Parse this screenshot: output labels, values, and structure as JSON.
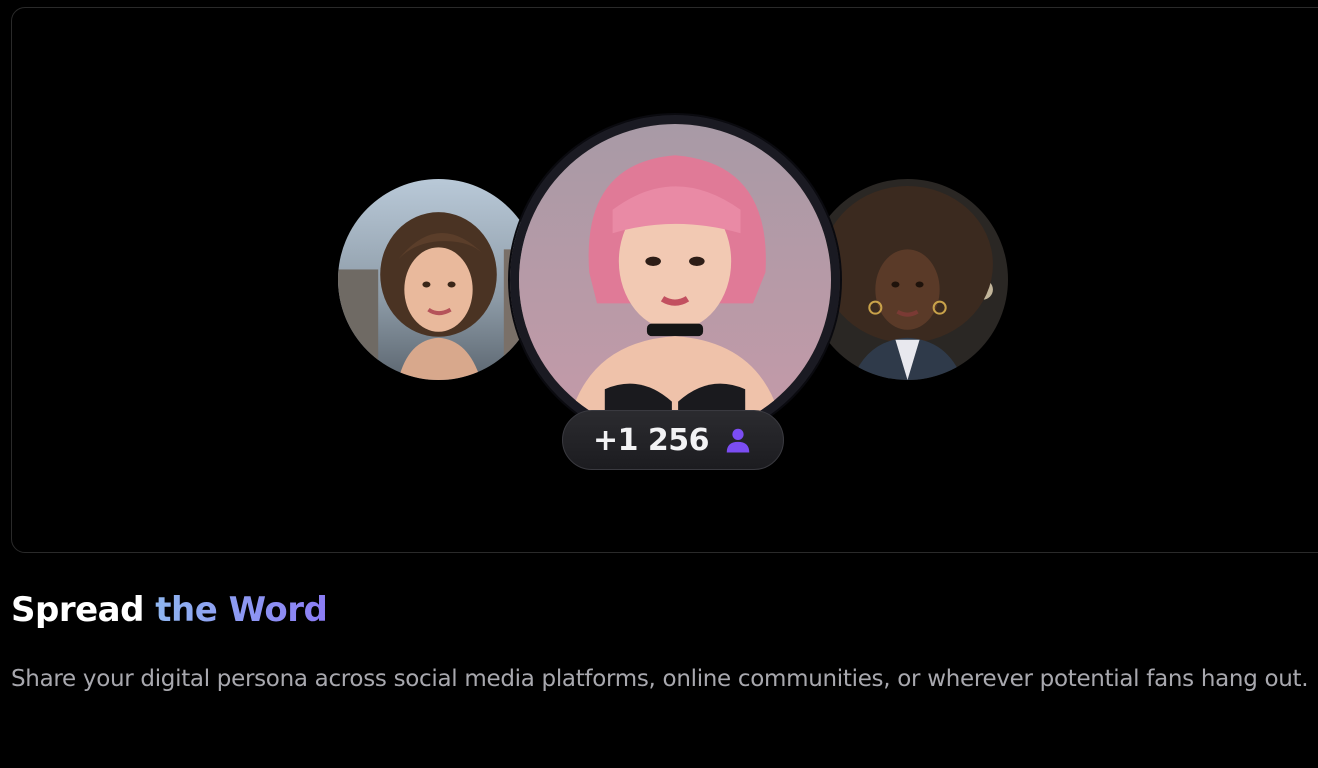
{
  "card": {
    "avatars": [
      {
        "name": "short-brown-hair-woman-portrait",
        "position": "left"
      },
      {
        "name": "pink-bob-hair-woman-portrait",
        "position": "center"
      },
      {
        "name": "curly-afro-hair-woman-portrait",
        "position": "right"
      }
    ],
    "count_label": "+1 256",
    "count_icon": "user-icon",
    "count_icon_color": "#7b4df2"
  },
  "heading": {
    "primary": "Spread",
    "accent": "the Word",
    "accent_gradient": [
      "#8fb6f0",
      "#8b7cf4"
    ]
  },
  "description": "Share your digital persona across social media platforms, online communities, or wherever potential fans hang out."
}
